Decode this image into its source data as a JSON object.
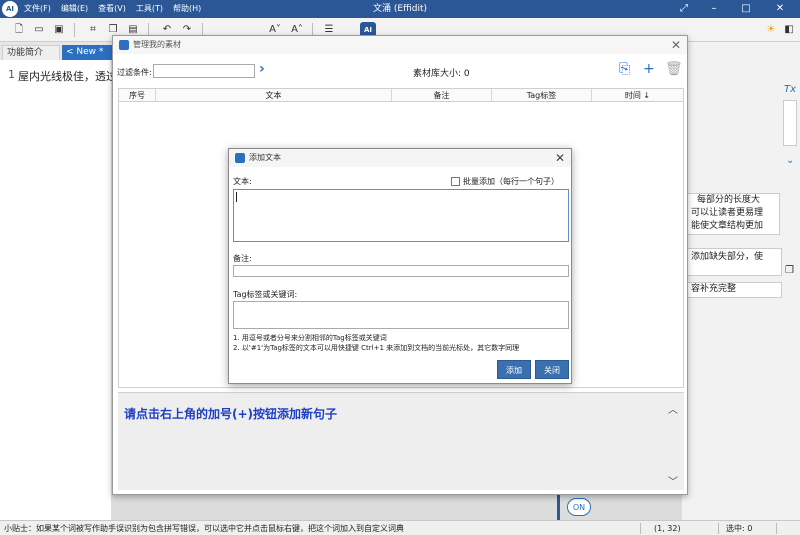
{
  "app": {
    "logo_text": "AI",
    "window_title": "文涌 (Effidit)",
    "menu": [
      "文件(F)",
      "编辑(E)",
      "查看(V)",
      "工具(T)",
      "帮助(H)"
    ],
    "toolbar_ai": "AI"
  },
  "tabs": [
    {
      "label": "功能简介"
    },
    {
      "label": "< New *  ×"
    }
  ],
  "editor": {
    "line_number": "1",
    "text": "屋内光线极佳，透过"
  },
  "right_panel": {
    "cards": [
      "每部分的长度大",
      "可以让读者更易理",
      "能使文章结构更加",
      "添加缺失部分，使",
      "容补充完整"
    ]
  },
  "material_dialog": {
    "title": "管理我的素材",
    "filter_label": "过滤条件:",
    "filter_value": "",
    "library_size": "素材库大小: 0",
    "columns": [
      "序号",
      "文本",
      "备注",
      "Tag标签",
      "时间 ↓"
    ],
    "hint": "请点击右上角的加号(+)按钮添加新句子"
  },
  "add_dialog": {
    "title": "添加文本",
    "text_label": "文本:",
    "batch_label": "批量添加（每行一个句子）",
    "note_label": "备注:",
    "tags_label": "Tag标签或关键词:",
    "help_1": "1. 用逗号或者分号来分割相邻的Tag标签或关键词",
    "help_2": "2. 以'#1'为Tag标签的文本可以用快捷键 Ctrl+1 来添加到文档的当前光标处，其它数字同理",
    "add_button": "添加",
    "close_button": "关闭"
  },
  "status": {
    "tip": "小贴士：如果某个词被写作助手误识别为包含拼写错误，可以选中它并点击鼠标右键，把这个词加入到自定义词典",
    "position": "(1, 32)",
    "selection": "选中: 0",
    "cloud": "ON"
  },
  "icons": {
    "accent": "#2b6fc1",
    "title_bg": "#2b5797"
  }
}
